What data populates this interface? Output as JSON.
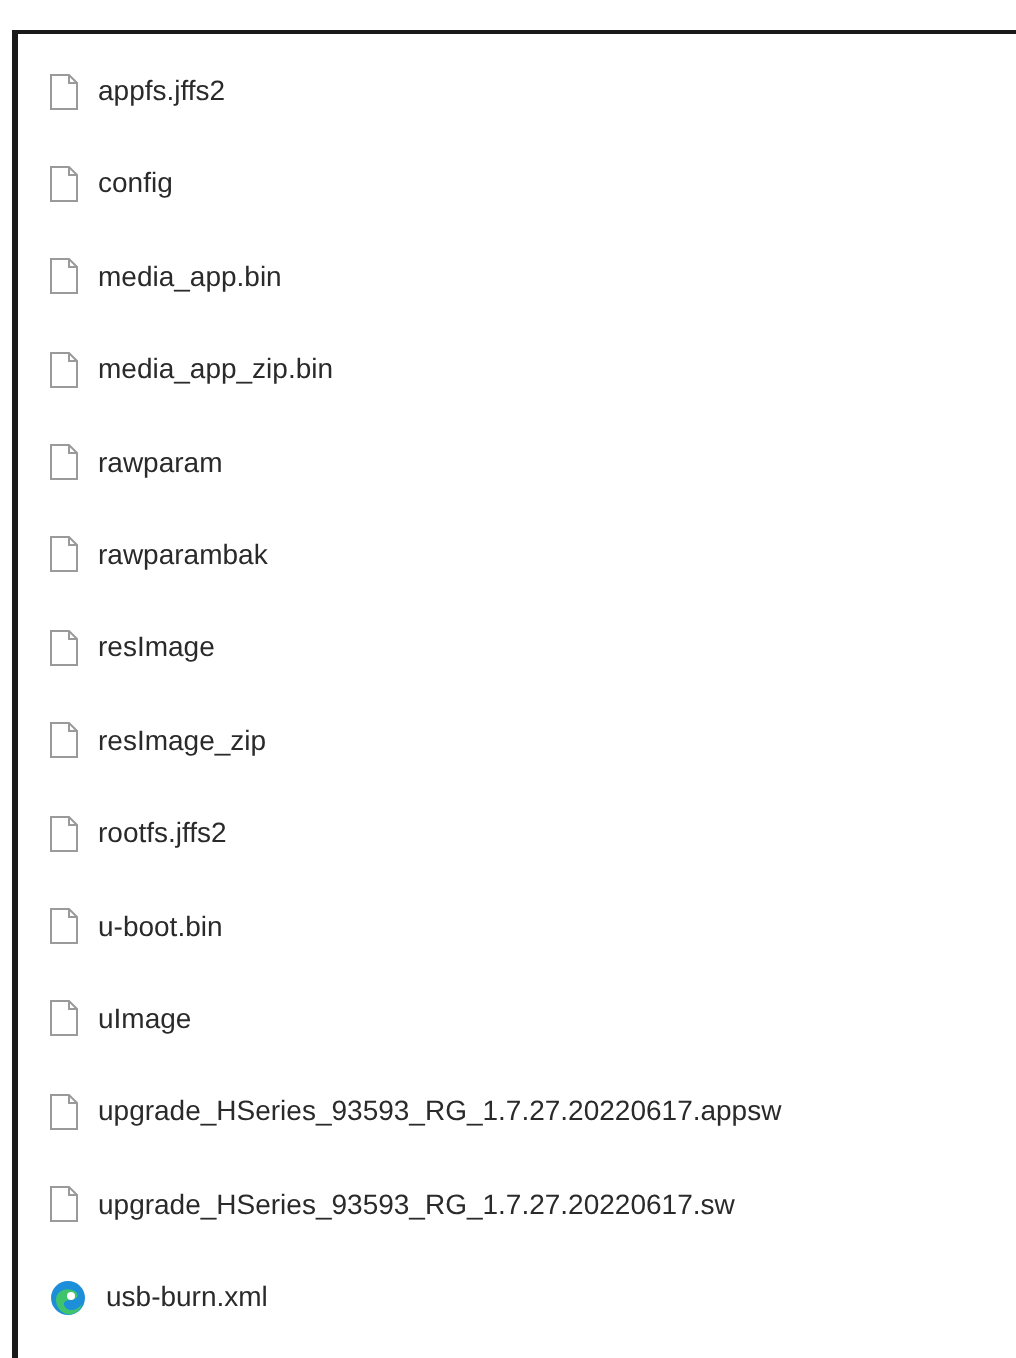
{
  "files": [
    {
      "name": "appfs.jffs2",
      "kind": "file"
    },
    {
      "name": "config",
      "kind": "file"
    },
    {
      "name": "media_app.bin",
      "kind": "file"
    },
    {
      "name": "media_app_zip.bin",
      "kind": "file"
    },
    {
      "name": "rawparam",
      "kind": "file"
    },
    {
      "name": "rawparambak",
      "kind": "file"
    },
    {
      "name": "resImage",
      "kind": "file"
    },
    {
      "name": "resImage_zip",
      "kind": "file"
    },
    {
      "name": "rootfs.jffs2",
      "kind": "file"
    },
    {
      "name": "u-boot.bin",
      "kind": "file"
    },
    {
      "name": "uImage",
      "kind": "file"
    },
    {
      "name": "upgrade_HSeries_93593_RG_1.7.27.20220617.appsw",
      "kind": "file"
    },
    {
      "name": "upgrade_HSeries_93593_RG_1.7.27.20220617.sw",
      "kind": "file"
    },
    {
      "name": "usb-burn.xml",
      "kind": "web"
    }
  ]
}
